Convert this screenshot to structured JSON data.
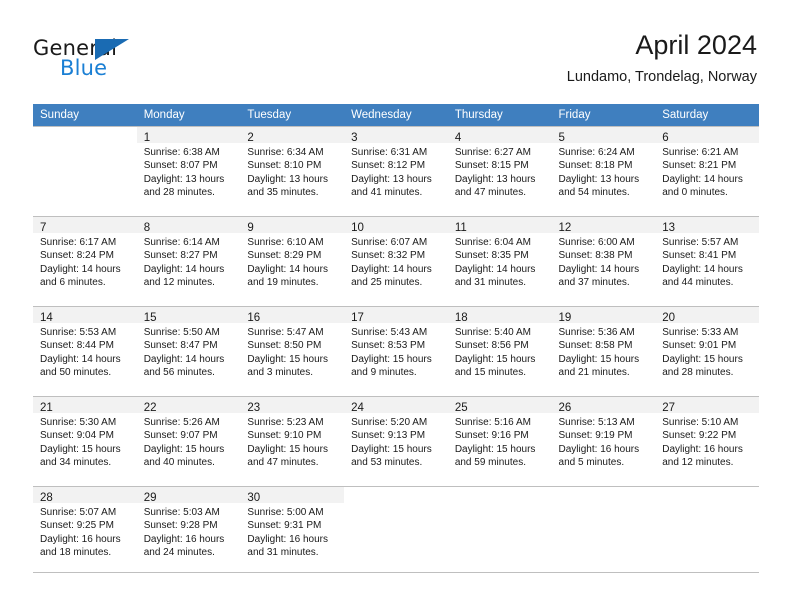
{
  "branding": {
    "logo_text_primary": "General",
    "logo_text_secondary": "Blue",
    "accent_color": "#1a7fd4",
    "triangle_color": "#1a6bb3"
  },
  "header": {
    "title": "April 2024",
    "subtitle": "Lundamo, Trondelag, Norway"
  },
  "calendar": {
    "header_bg": "#3f7fbf",
    "weekdays": [
      "Sunday",
      "Monday",
      "Tuesday",
      "Wednesday",
      "Thursday",
      "Friday",
      "Saturday"
    ],
    "weeks": [
      [
        {
          "day": "",
          "sunrise": "",
          "sunset": "",
          "daylight1": "",
          "daylight2": ""
        },
        {
          "day": "1",
          "sunrise": "Sunrise: 6:38 AM",
          "sunset": "Sunset: 8:07 PM",
          "daylight1": "Daylight: 13 hours",
          "daylight2": "and 28 minutes."
        },
        {
          "day": "2",
          "sunrise": "Sunrise: 6:34 AM",
          "sunset": "Sunset: 8:10 PM",
          "daylight1": "Daylight: 13 hours",
          "daylight2": "and 35 minutes."
        },
        {
          "day": "3",
          "sunrise": "Sunrise: 6:31 AM",
          "sunset": "Sunset: 8:12 PM",
          "daylight1": "Daylight: 13 hours",
          "daylight2": "and 41 minutes."
        },
        {
          "day": "4",
          "sunrise": "Sunrise: 6:27 AM",
          "sunset": "Sunset: 8:15 PM",
          "daylight1": "Daylight: 13 hours",
          "daylight2": "and 47 minutes."
        },
        {
          "day": "5",
          "sunrise": "Sunrise: 6:24 AM",
          "sunset": "Sunset: 8:18 PM",
          "daylight1": "Daylight: 13 hours",
          "daylight2": "and 54 minutes."
        },
        {
          "day": "6",
          "sunrise": "Sunrise: 6:21 AM",
          "sunset": "Sunset: 8:21 PM",
          "daylight1": "Daylight: 14 hours",
          "daylight2": "and 0 minutes."
        }
      ],
      [
        {
          "day": "7",
          "sunrise": "Sunrise: 6:17 AM",
          "sunset": "Sunset: 8:24 PM",
          "daylight1": "Daylight: 14 hours",
          "daylight2": "and 6 minutes."
        },
        {
          "day": "8",
          "sunrise": "Sunrise: 6:14 AM",
          "sunset": "Sunset: 8:27 PM",
          "daylight1": "Daylight: 14 hours",
          "daylight2": "and 12 minutes."
        },
        {
          "day": "9",
          "sunrise": "Sunrise: 6:10 AM",
          "sunset": "Sunset: 8:29 PM",
          "daylight1": "Daylight: 14 hours",
          "daylight2": "and 19 minutes."
        },
        {
          "day": "10",
          "sunrise": "Sunrise: 6:07 AM",
          "sunset": "Sunset: 8:32 PM",
          "daylight1": "Daylight: 14 hours",
          "daylight2": "and 25 minutes."
        },
        {
          "day": "11",
          "sunrise": "Sunrise: 6:04 AM",
          "sunset": "Sunset: 8:35 PM",
          "daylight1": "Daylight: 14 hours",
          "daylight2": "and 31 minutes."
        },
        {
          "day": "12",
          "sunrise": "Sunrise: 6:00 AM",
          "sunset": "Sunset: 8:38 PM",
          "daylight1": "Daylight: 14 hours",
          "daylight2": "and 37 minutes."
        },
        {
          "day": "13",
          "sunrise": "Sunrise: 5:57 AM",
          "sunset": "Sunset: 8:41 PM",
          "daylight1": "Daylight: 14 hours",
          "daylight2": "and 44 minutes."
        }
      ],
      [
        {
          "day": "14",
          "sunrise": "Sunrise: 5:53 AM",
          "sunset": "Sunset: 8:44 PM",
          "daylight1": "Daylight: 14 hours",
          "daylight2": "and 50 minutes."
        },
        {
          "day": "15",
          "sunrise": "Sunrise: 5:50 AM",
          "sunset": "Sunset: 8:47 PM",
          "daylight1": "Daylight: 14 hours",
          "daylight2": "and 56 minutes."
        },
        {
          "day": "16",
          "sunrise": "Sunrise: 5:47 AM",
          "sunset": "Sunset: 8:50 PM",
          "daylight1": "Daylight: 15 hours",
          "daylight2": "and 3 minutes."
        },
        {
          "day": "17",
          "sunrise": "Sunrise: 5:43 AM",
          "sunset": "Sunset: 8:53 PM",
          "daylight1": "Daylight: 15 hours",
          "daylight2": "and 9 minutes."
        },
        {
          "day": "18",
          "sunrise": "Sunrise: 5:40 AM",
          "sunset": "Sunset: 8:56 PM",
          "daylight1": "Daylight: 15 hours",
          "daylight2": "and 15 minutes."
        },
        {
          "day": "19",
          "sunrise": "Sunrise: 5:36 AM",
          "sunset": "Sunset: 8:58 PM",
          "daylight1": "Daylight: 15 hours",
          "daylight2": "and 21 minutes."
        },
        {
          "day": "20",
          "sunrise": "Sunrise: 5:33 AM",
          "sunset": "Sunset: 9:01 PM",
          "daylight1": "Daylight: 15 hours",
          "daylight2": "and 28 minutes."
        }
      ],
      [
        {
          "day": "21",
          "sunrise": "Sunrise: 5:30 AM",
          "sunset": "Sunset: 9:04 PM",
          "daylight1": "Daylight: 15 hours",
          "daylight2": "and 34 minutes."
        },
        {
          "day": "22",
          "sunrise": "Sunrise: 5:26 AM",
          "sunset": "Sunset: 9:07 PM",
          "daylight1": "Daylight: 15 hours",
          "daylight2": "and 40 minutes."
        },
        {
          "day": "23",
          "sunrise": "Sunrise: 5:23 AM",
          "sunset": "Sunset: 9:10 PM",
          "daylight1": "Daylight: 15 hours",
          "daylight2": "and 47 minutes."
        },
        {
          "day": "24",
          "sunrise": "Sunrise: 5:20 AM",
          "sunset": "Sunset: 9:13 PM",
          "daylight1": "Daylight: 15 hours",
          "daylight2": "and 53 minutes."
        },
        {
          "day": "25",
          "sunrise": "Sunrise: 5:16 AM",
          "sunset": "Sunset: 9:16 PM",
          "daylight1": "Daylight: 15 hours",
          "daylight2": "and 59 minutes."
        },
        {
          "day": "26",
          "sunrise": "Sunrise: 5:13 AM",
          "sunset": "Sunset: 9:19 PM",
          "daylight1": "Daylight: 16 hours",
          "daylight2": "and 5 minutes."
        },
        {
          "day": "27",
          "sunrise": "Sunrise: 5:10 AM",
          "sunset": "Sunset: 9:22 PM",
          "daylight1": "Daylight: 16 hours",
          "daylight2": "and 12 minutes."
        }
      ],
      [
        {
          "day": "28",
          "sunrise": "Sunrise: 5:07 AM",
          "sunset": "Sunset: 9:25 PM",
          "daylight1": "Daylight: 16 hours",
          "daylight2": "and 18 minutes."
        },
        {
          "day": "29",
          "sunrise": "Sunrise: 5:03 AM",
          "sunset": "Sunset: 9:28 PM",
          "daylight1": "Daylight: 16 hours",
          "daylight2": "and 24 minutes."
        },
        {
          "day": "30",
          "sunrise": "Sunrise: 5:00 AM",
          "sunset": "Sunset: 9:31 PM",
          "daylight1": "Daylight: 16 hours",
          "daylight2": "and 31 minutes."
        },
        {
          "day": "",
          "sunrise": "",
          "sunset": "",
          "daylight1": "",
          "daylight2": ""
        },
        {
          "day": "",
          "sunrise": "",
          "sunset": "",
          "daylight1": "",
          "daylight2": ""
        },
        {
          "day": "",
          "sunrise": "",
          "sunset": "",
          "daylight1": "",
          "daylight2": ""
        },
        {
          "day": "",
          "sunrise": "",
          "sunset": "",
          "daylight1": "",
          "daylight2": ""
        }
      ]
    ]
  }
}
